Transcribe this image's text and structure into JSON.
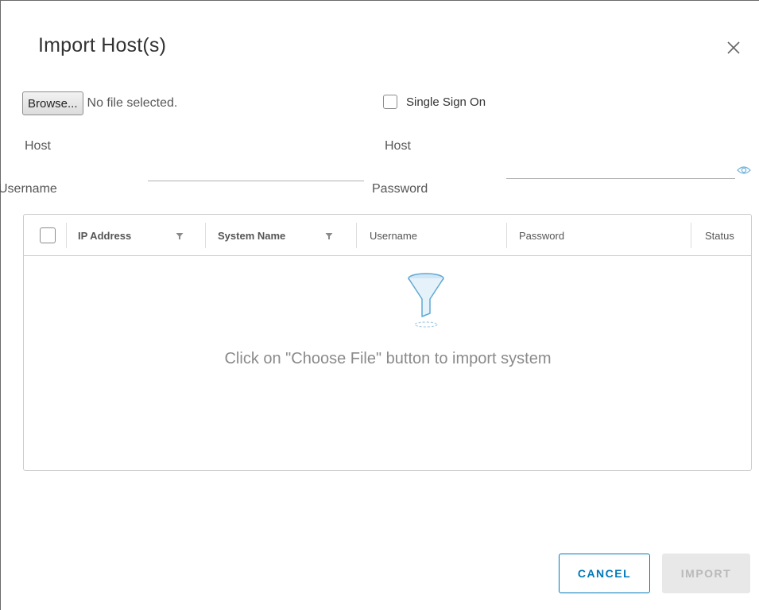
{
  "dialog": {
    "title": "Import Host(s)"
  },
  "file": {
    "browse_label": "Browse...",
    "status": "No file selected."
  },
  "sso": {
    "label": "Single Sign On",
    "checked": false
  },
  "form": {
    "host_left_label": "Host",
    "host_right_label": "Host",
    "username_label": "Username",
    "username_value": "",
    "password_label": "Password",
    "password_value": ""
  },
  "table": {
    "columns": [
      "IP Address",
      "System Name",
      "Username",
      "Password",
      "Status"
    ],
    "rows": [],
    "empty_message": "Click on \"Choose File\" button to import system"
  },
  "actions": {
    "cancel_label": "CANCEL",
    "import_label": "IMPORT"
  },
  "colors": {
    "accent": "#0079b8",
    "disabled_bg": "#e8e8e8",
    "disabled_text": "#b9b9b9",
    "empty_icon": "#5fa8d3"
  },
  "icons": {
    "close": "close-icon",
    "eye": "eye-icon",
    "filter": "filter-icon",
    "empty": "funnel-icon"
  }
}
